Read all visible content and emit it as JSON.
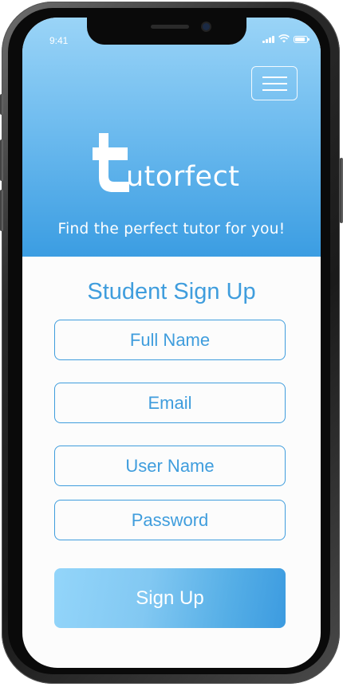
{
  "status_bar": {
    "time": "9:41"
  },
  "header": {
    "menu_icon": "hamburger-menu-icon",
    "logo": {
      "glyph": "t",
      "wordmark": "utorfect"
    },
    "tagline": "Find the perfect tutor for you!"
  },
  "form": {
    "title": "Student Sign Up",
    "fields": {
      "full_name": {
        "placeholder": "Full Name",
        "value": ""
      },
      "email": {
        "placeholder": "Email",
        "value": ""
      },
      "user_name": {
        "placeholder": "User Name",
        "value": ""
      },
      "password": {
        "placeholder": "Password",
        "value": ""
      }
    },
    "submit_label": "Sign Up"
  },
  "colors": {
    "accent": "#3f9ddd",
    "header_top": "#9ad4f7",
    "header_bottom": "#3b9de2",
    "button_left": "#93d5fa",
    "button_right": "#3c9be0",
    "background": "#fcfcfc"
  }
}
